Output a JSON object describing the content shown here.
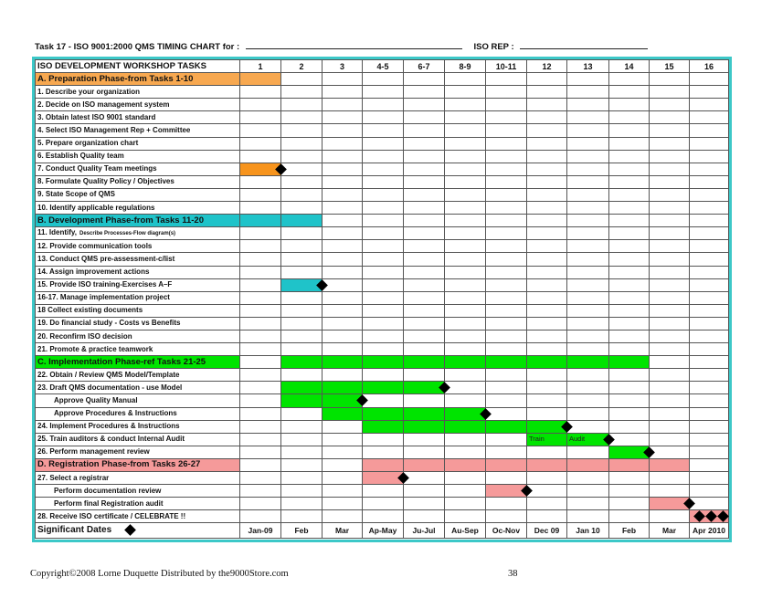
{
  "header": {
    "title": "Task 17 - ISO 9001:2000 QMS TIMING CHART for :",
    "iso_rep_label": "ISO REP :"
  },
  "colors": {
    "phase_a": "#f7a850",
    "phase_a_bar": "#f7941d",
    "phase_b": "#1fc3c9",
    "phase_c": "#00e400",
    "phase_d": "#f59a9a",
    "frame": "#3cc8c8"
  },
  "table": {
    "corner_header": "ISO DEVELOPMENT WORKSHOP TASKS",
    "columns": [
      "1",
      "2",
      "3",
      "4-5",
      "6-7",
      "8-9",
      "10-11",
      "12",
      "13",
      "14",
      "15",
      "16"
    ],
    "rows": [
      {
        "label": "A. Preparation Phase-from Tasks 1-10",
        "type": "phase",
        "color": "phase_a",
        "bar": [
          0,
          0
        ]
      },
      {
        "label": "1. Describe your organization"
      },
      {
        "label": "2. Decide on ISO management system"
      },
      {
        "label": "3. Obtain latest ISO 9001 standard"
      },
      {
        "label": "4. Select ISO Management Rep + Committee"
      },
      {
        "label": "5. Prepare organization chart"
      },
      {
        "label": "6. Establish Quality team"
      },
      {
        "label": "7. Conduct Quality Team meetings",
        "color": "phase_a_bar",
        "bar": [
          0,
          0
        ],
        "milestone": 1
      },
      {
        "label": "8. Formulate Quality Policy / Objectives"
      },
      {
        "label": "9. State Scope of QMS"
      },
      {
        "label": "10. Identify applicable regulations"
      },
      {
        "label": "B. Development Phase-from Tasks 11-20",
        "type": "phase",
        "color": "phase_b",
        "bar": [
          0,
          1
        ]
      },
      {
        "label": "11. Identify,",
        "label_small": "Describe Processes-Flow diagram(s)"
      },
      {
        "label": "12. Provide communication tools"
      },
      {
        "label": "13. Conduct QMS pre-assessment-c/list"
      },
      {
        "label": "14. Assign improvement actions"
      },
      {
        "label": "15. Provide ISO training-Exercises A–F",
        "color": "phase_b",
        "bar": [
          1,
          1
        ],
        "milestone": 2
      },
      {
        "label": "16-17. Manage implementation project"
      },
      {
        "label": "18 Collect existing documents"
      },
      {
        "label": "19. Do financial study - Costs vs Benefits"
      },
      {
        "label": "20. Reconfirm ISO decision"
      },
      {
        "label": "21. Promote & practice teamwork"
      },
      {
        "label": "C. Implementation Phase-ref Tasks 21-25",
        "type": "phase",
        "color": "phase_c",
        "bar": [
          1,
          9
        ]
      },
      {
        "label": "22. Obtain / Review QMS Model/Template"
      },
      {
        "label": "23. Draft QMS documentation - use Model",
        "color": "phase_c",
        "bar": [
          1,
          4
        ],
        "milestone": 5
      },
      {
        "label": "Approve Quality Manual",
        "indent": true,
        "color": "phase_c",
        "bar": [
          1,
          2
        ],
        "milestone": 3
      },
      {
        "label": "Approve Procedures & Instructions",
        "indent": true,
        "color": "phase_c",
        "bar": [
          2,
          5
        ],
        "milestone": 6
      },
      {
        "label": "24. Implement Procedures & Instructions",
        "color": "phase_c",
        "bar": [
          3,
          7
        ],
        "milestone": 8
      },
      {
        "label": "25. Train auditors & conduct Internal Audit",
        "color": "phase_c",
        "bar": [
          7,
          8
        ],
        "milestone": 9,
        "bar_texts": [
          {
            "col": 7,
            "text": "Train"
          },
          {
            "col": 8,
            "text": "Audit"
          }
        ]
      },
      {
        "label": "26. Perform  management review",
        "color": "phase_c",
        "bar": [
          9,
          9
        ],
        "milestone": 10
      },
      {
        "label": "D. Registration Phase-from Tasks 26-27",
        "type": "phase",
        "color": "phase_d",
        "bar": [
          3,
          10
        ]
      },
      {
        "label": "27. Select a registrar",
        "color": "phase_d",
        "bar": [
          3,
          3
        ],
        "milestone": 4
      },
      {
        "label": "Perform documentation review",
        "indent": true,
        "color": "phase_d",
        "bar": [
          6,
          6
        ],
        "milestone": 7
      },
      {
        "label": "Perform final Registration audit",
        "indent": true,
        "color": "phase_d",
        "bar": [
          10,
          10
        ],
        "milestone": 11
      },
      {
        "label": "28. Receive ISO certificate / CELEBRATE !!",
        "color": "phase_d",
        "bar": [
          11,
          11
        ],
        "celebrate": 3
      }
    ],
    "significant_dates_label": "Significant Dates",
    "dates": [
      "Jan-09",
      "Feb",
      "Mar",
      "Ap-May",
      "Ju-Jul",
      "Au-Sep",
      "Oc-Nov",
      "Dec 09",
      "Jan 10",
      "Feb",
      "Mar",
      "Apr 2010"
    ]
  },
  "footer": {
    "copyright": "Copyright©2008 Lorne Duquette Distributed by the9000Store.com",
    "page_number": "38"
  }
}
